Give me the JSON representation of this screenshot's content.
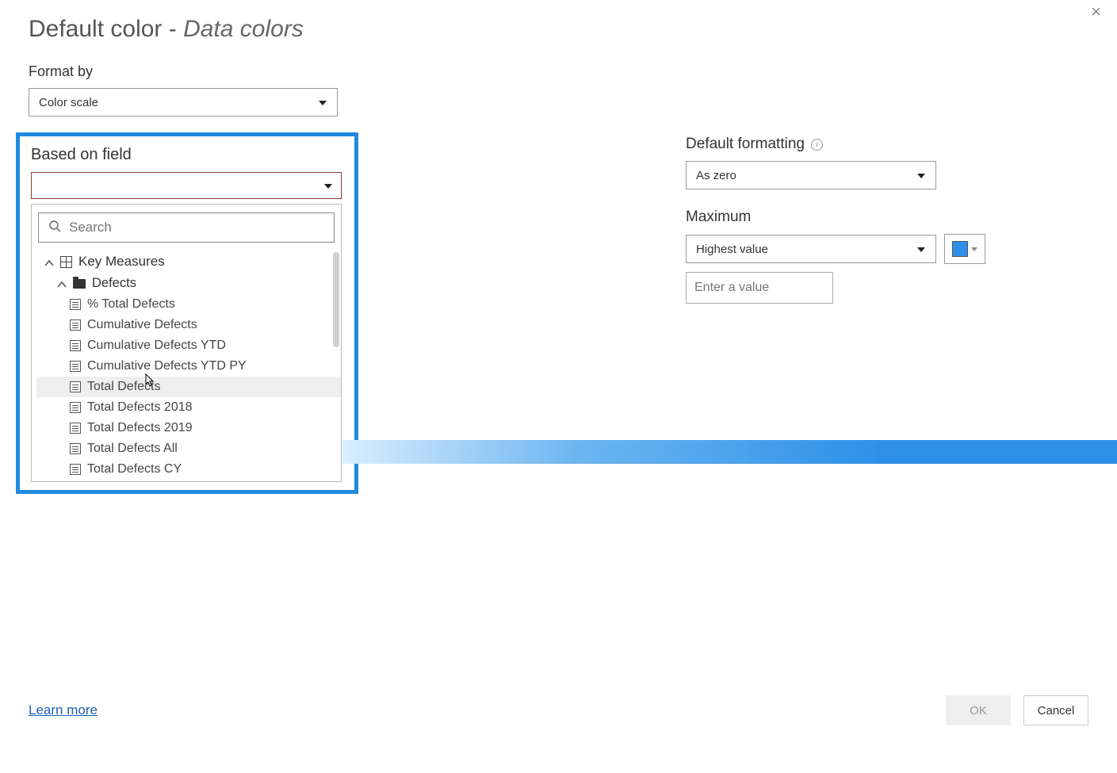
{
  "header": {
    "title_prefix": "Default color - ",
    "title_italic": "Data colors"
  },
  "format_by": {
    "label": "Format by",
    "value": "Color scale"
  },
  "based_on_field": {
    "label": "Based on field",
    "value": "",
    "search_placeholder": "Search",
    "tree": {
      "group": "Key Measures",
      "folder": "Defects",
      "items": [
        "% Total Defects",
        "Cumulative Defects",
        "Cumulative Defects YTD",
        "Cumulative Defects YTD PY",
        "Total Defects",
        "Total Defects 2018",
        "Total Defects 2019",
        "Total Defects All",
        "Total Defects CY"
      ],
      "hover_index": 4
    }
  },
  "default_formatting": {
    "label": "Default formatting",
    "value": "As zero"
  },
  "maximum": {
    "label": "Maximum",
    "value": "Highest value",
    "input_placeholder": "Enter a value",
    "color_swatch": "#2C8EE6"
  },
  "footer": {
    "learn_more": "Learn more",
    "ok": "OK",
    "cancel": "Cancel"
  }
}
